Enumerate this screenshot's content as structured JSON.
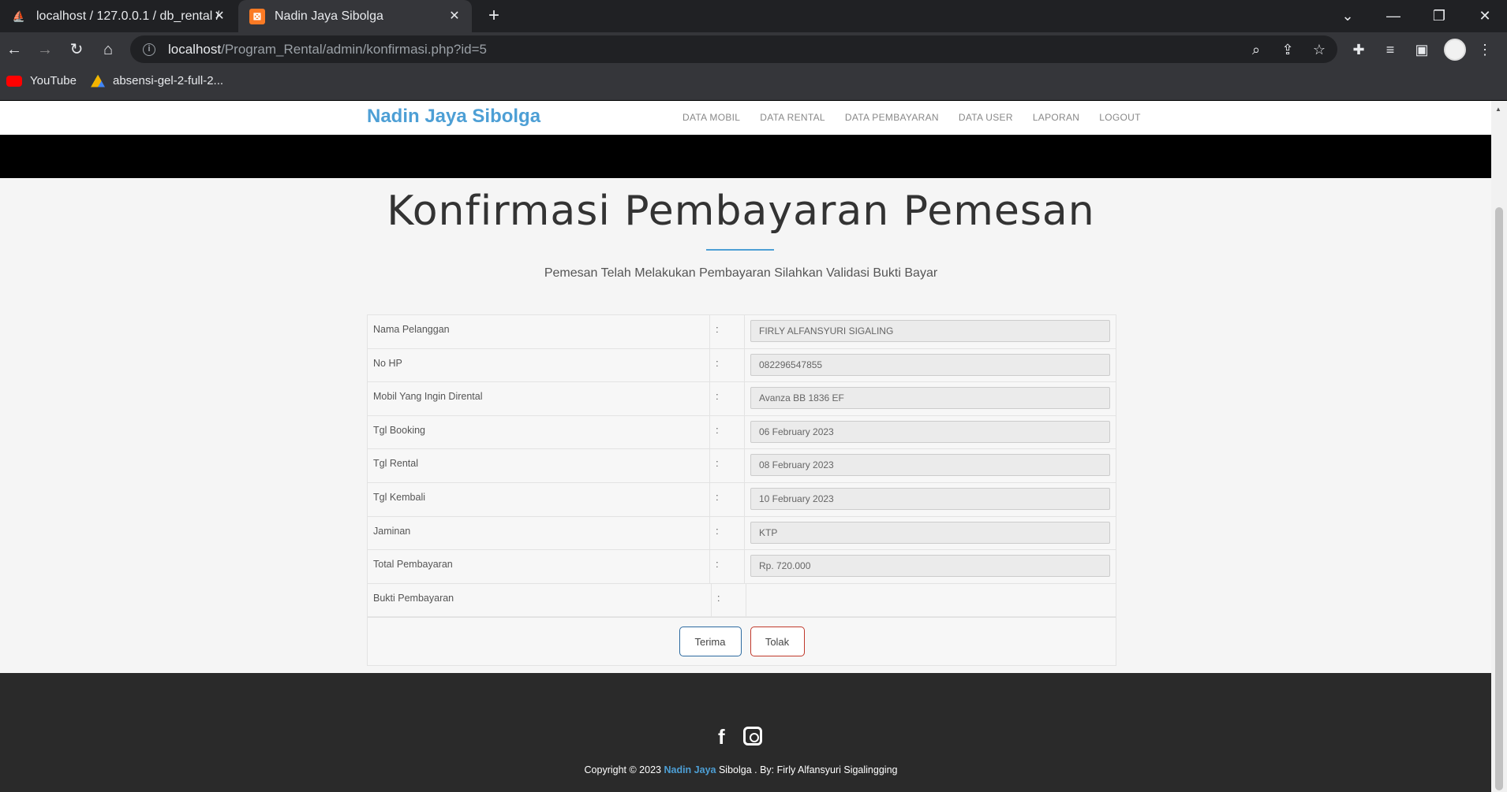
{
  "browser": {
    "tabs": [
      {
        "title": "localhost / 127.0.0.1 / db_rental /",
        "active": false
      },
      {
        "title": "Nadin Jaya Sibolga",
        "active": true
      }
    ],
    "url_host": "localhost",
    "url_path": "/Program_Rental/admin/konfirmasi.php?id=5",
    "bookmarks": [
      {
        "label": "YouTube"
      },
      {
        "label": "absensi-gel-2-full-2..."
      }
    ]
  },
  "navbar": {
    "brand": "Nadin Jaya Sibolga",
    "links": [
      "DATA MOBIL",
      "DATA RENTAL",
      "DATA PEMBAYARAN",
      "DATA USER",
      "LAPORAN",
      "LOGOUT"
    ]
  },
  "page": {
    "title": "Konfirmasi Pembayaran Pemesan",
    "subtitle": "Pemesan Telah Melakukan Pembayaran Silahkan Validasi Bukti Bayar"
  },
  "form": {
    "colon": ":",
    "rows": [
      {
        "label": "Nama Pelanggan",
        "value": "FIRLY ALFANSYURI SIGALING"
      },
      {
        "label": "No HP",
        "value": "082296547855"
      },
      {
        "label": "Mobil Yang Ingin Dirental",
        "value": "Avanza BB 1836 EF"
      },
      {
        "label": "Tgl Booking",
        "value": "06 February 2023"
      },
      {
        "label": "Tgl Rental",
        "value": "08 February 2023"
      },
      {
        "label": "Tgl Kembali",
        "value": "10 February 2023"
      },
      {
        "label": "Jaminan",
        "value": "KTP"
      },
      {
        "label": "Total Pembayaran",
        "value": "Rp. 720.000"
      },
      {
        "label": "Bukti Pembayaran",
        "value": ""
      }
    ],
    "accept_label": "Terima",
    "reject_label": "Tolak"
  },
  "footer": {
    "copyright_prefix": "Copyright © 2023",
    "brand_highlight": "Nadin Jaya",
    "copyright_suffix": "Sibolga . By: Firly Alfansyuri Sigalingging"
  },
  "colors": {
    "accent": "#4d9fd5",
    "accept_border": "#2c6aa0",
    "reject_border": "#c0392b"
  }
}
